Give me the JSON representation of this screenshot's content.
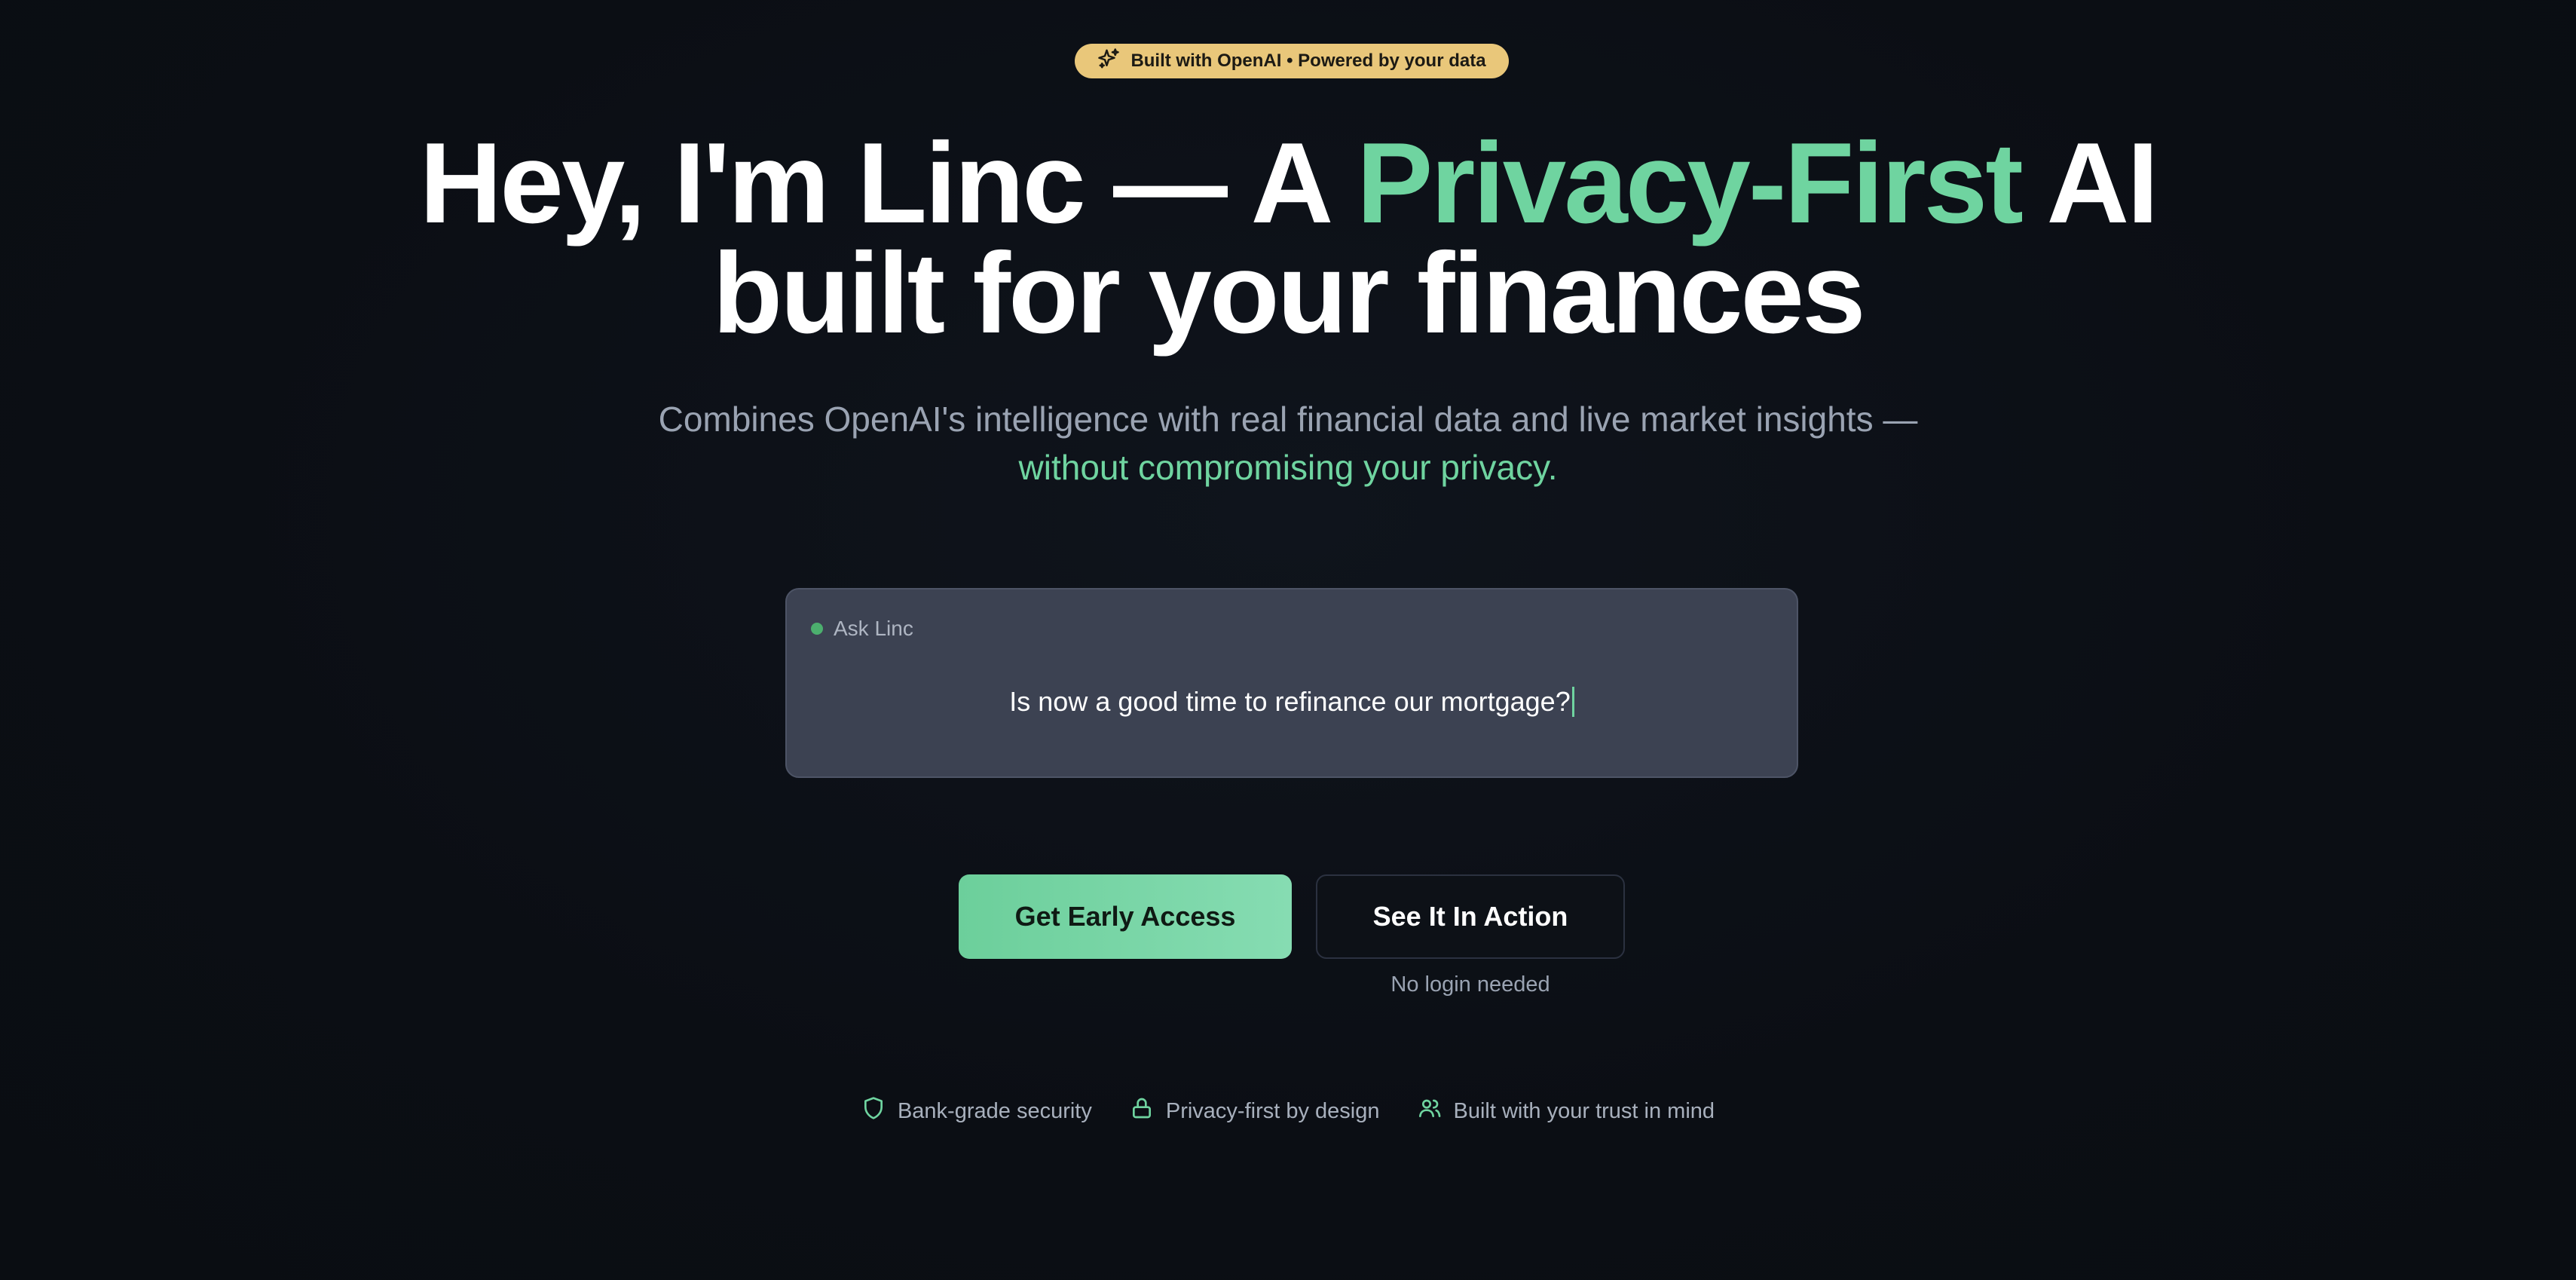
{
  "badge": {
    "text": "Built with OpenAI • Powered by your data",
    "icon": "sparkles-icon"
  },
  "headline": {
    "part1": "Hey, I'm Linc — A ",
    "accent": "Privacy-First",
    "part2": " AI",
    "line2": "built for your finances"
  },
  "subheadline": {
    "line1": "Combines OpenAI's intelligence with real financial data and live market insights —",
    "line2": "without compromising your privacy."
  },
  "ask": {
    "label": "Ask Linc",
    "query": "Is now a good time to refinance our mortgage?"
  },
  "cta": {
    "primary": "Get Early Access",
    "secondary": "See It In Action",
    "secondary_note": "No login needed"
  },
  "trust": [
    {
      "label": "Bank-grade security",
      "icon": "shield-icon"
    },
    {
      "label": "Privacy-first by design",
      "icon": "lock-icon"
    },
    {
      "label": "Built with your trust in mind",
      "icon": "users-icon"
    }
  ],
  "colors": {
    "accent": "#6fd4a0",
    "badge": "#e9c77a",
    "background": "#0b0f15"
  }
}
